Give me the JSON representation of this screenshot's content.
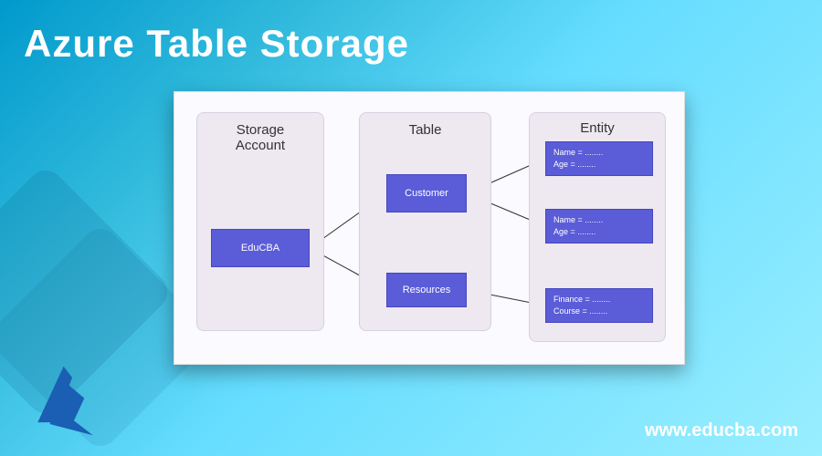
{
  "title": "Azure Table Storage",
  "website_url": "www.educba.com",
  "diagram": {
    "columns": {
      "storage_account": {
        "header": "Storage\nAccount"
      },
      "table": {
        "header": "Table"
      },
      "entity": {
        "header": "Entity"
      }
    },
    "nodes": {
      "educba": {
        "label": "EduCBA"
      },
      "customer": {
        "label": "Customer"
      },
      "resources": {
        "label": "Resources"
      },
      "entity1": {
        "line1": "Name = ........",
        "line2": "Age = ........"
      },
      "entity2": {
        "line1": "Name = ........",
        "line2": "Age = ........"
      },
      "entity3": {
        "line1": "Finance = ........",
        "line2": "Course = ........"
      }
    }
  },
  "chart_data": {
    "type": "diagram",
    "title": "Azure Table Storage",
    "structure": [
      {
        "level": "Storage Account",
        "items": [
          "EduCBA"
        ]
      },
      {
        "level": "Table",
        "items": [
          "Customer",
          "Resources"
        ]
      },
      {
        "level": "Entity",
        "items": [
          {
            "Name": "........",
            "Age": "........"
          },
          {
            "Name": "........",
            "Age": "........"
          },
          {
            "Finance": "........",
            "Course": "........"
          }
        ]
      }
    ],
    "edges": [
      {
        "from": "EduCBA",
        "to": "Customer"
      },
      {
        "from": "EduCBA",
        "to": "Resources"
      },
      {
        "from": "Customer",
        "to": "Entity[0]"
      },
      {
        "from": "Customer",
        "to": "Entity[1]"
      },
      {
        "from": "Resources",
        "to": "Entity[2]"
      }
    ]
  }
}
